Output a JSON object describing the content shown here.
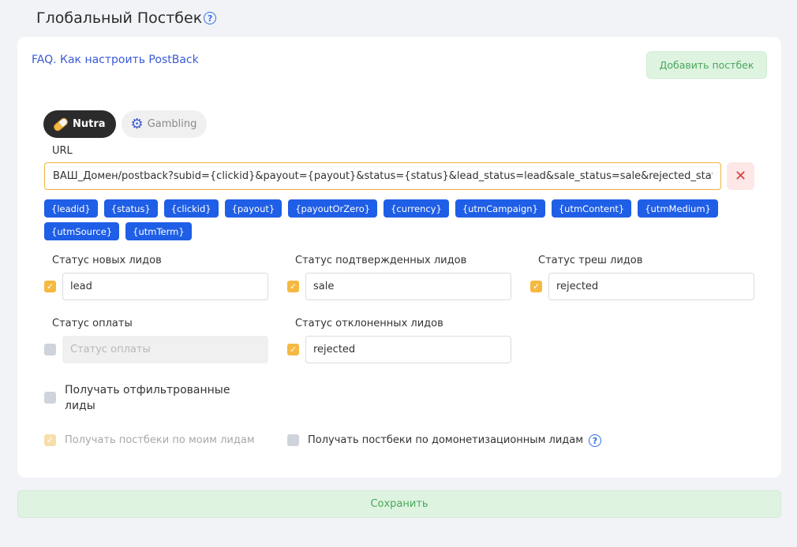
{
  "page": {
    "title": "Глобальный Постбек"
  },
  "card": {
    "faq_link": "FAQ. Как настроить PostBack",
    "add_button": "Добавить постбек",
    "tabs": [
      {
        "label": "Nutra",
        "icon": "pill-icon",
        "active": true
      },
      {
        "label": "Gambling",
        "icon": "gear-icon",
        "active": false
      }
    ],
    "url_label": "URL",
    "url_value": "ВАШ_Домен/postback?subid={clickid}&payout={payout}&status={status}&lead_status=lead&sale_status=sale&rejected_status=rejected",
    "remove_label": "✕",
    "macros": [
      "{leadid}",
      "{status}",
      "{clickid}",
      "{payout}",
      "{payoutOrZero}",
      "{currency}",
      "{utmCampaign}",
      "{utmContent}",
      "{utmMedium}",
      "{utmSource}",
      "{utmTerm}"
    ],
    "statuses": {
      "new": {
        "label": "Статус новых лидов",
        "value": "lead",
        "checked": true
      },
      "confirmed": {
        "label": "Статус подтвержденных лидов",
        "value": "sale",
        "checked": true
      },
      "trash": {
        "label": "Статус треш лидов",
        "value": "rejected",
        "checked": true
      },
      "payment": {
        "label": "Статус оплаты",
        "value": "",
        "placeholder": "Статус оплаты",
        "checked": false
      },
      "declined": {
        "label": "Статус отклоненных лидов",
        "value": "rejected",
        "checked": true
      }
    },
    "options": {
      "filtered": "Получать отфильтрованные лиды",
      "my_leads": "Получать постбеки по моим лидам",
      "demonetization": "Получать постбеки по домонетизационным лидам"
    }
  },
  "save_button": "Сохранить",
  "colors": {
    "accent": "#1f5ee6",
    "checkbox": "#f5b942",
    "success_bg": "#dff3e1",
    "success_text": "#49a85a"
  }
}
